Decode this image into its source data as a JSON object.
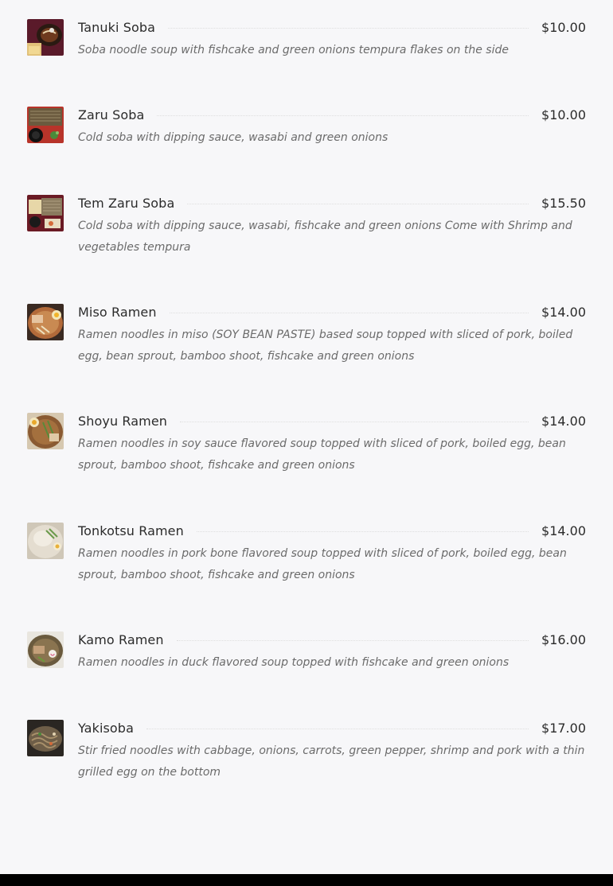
{
  "menu": {
    "items": [
      {
        "name": "Tanuki Soba",
        "price": "$10.00",
        "description": "Soba noodle soup with fishcake and green onions tempura flakes on the side"
      },
      {
        "name": "Zaru Soba",
        "price": "$10.00",
        "description": "Cold soba with dipping sauce, wasabi and green onions"
      },
      {
        "name": "Tem Zaru Soba",
        "price": "$15.50",
        "description": "Cold soba with dipping sauce, wasabi, fishcake and green onions Come with Shrimp and vegetables tempura"
      },
      {
        "name": "Miso Ramen",
        "price": "$14.00",
        "description": "Ramen noodles in miso (SOY BEAN PASTE) based soup topped with sliced of pork, boiled egg, bean sprout, bamboo shoot, fishcake and green onions"
      },
      {
        "name": "Shoyu Ramen",
        "price": "$14.00",
        "description": "Ramen noodles in soy sauce flavored soup topped with sliced of pork, boiled egg, bean sprout, bamboo shoot, fishcake and green onions"
      },
      {
        "name": "Tonkotsu Ramen",
        "price": "$14.00",
        "description": "Ramen noodles in pork bone flavored soup topped with sliced of pork, boiled egg, bean sprout, bamboo shoot, fishcake and green onions"
      },
      {
        "name": "Kamo Ramen",
        "price": "$16.00",
        "description": "Ramen noodles in duck flavored soup topped with fishcake and green onions"
      },
      {
        "name": "Yakisoba",
        "price": "$17.00",
        "description": "Stir fried noodles with cabbage, onions, carrots, green pepper, shrimp and pork with a thin grilled egg on the bottom"
      }
    ]
  }
}
